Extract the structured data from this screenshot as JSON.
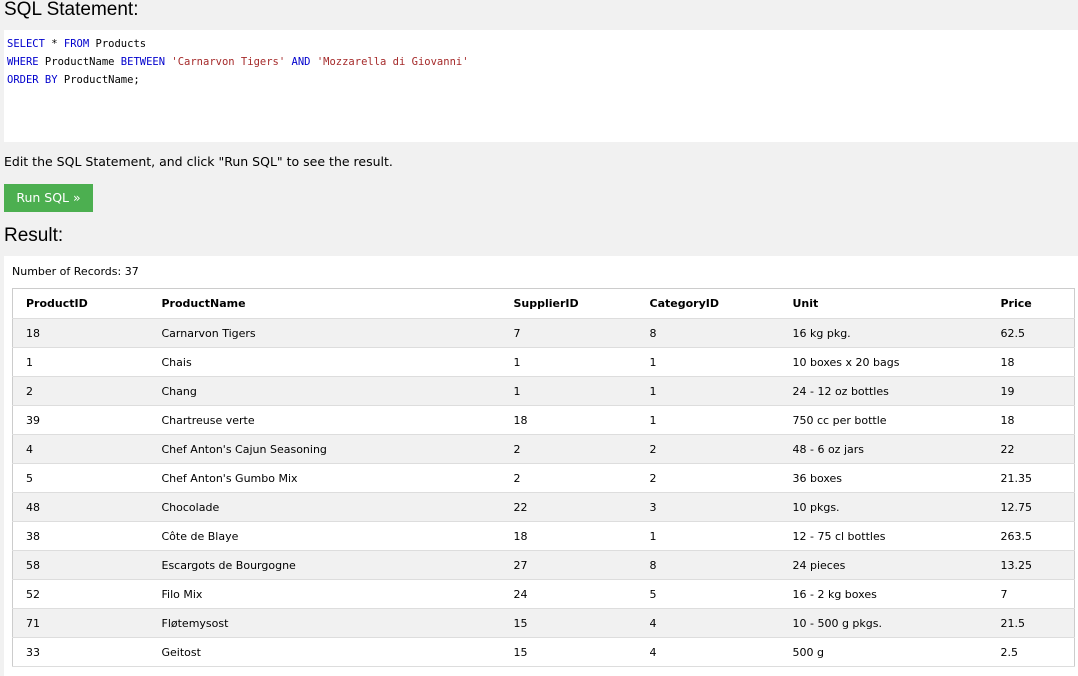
{
  "sql_heading": "SQL Statement:",
  "sql": {
    "line1": {
      "k1": "SELECT",
      "t1": " * ",
      "k2": "FROM",
      "t2": " Products"
    },
    "line2": {
      "k1": "WHERE",
      "t1": " ProductName ",
      "k2": "BETWEEN",
      "s1": "'Carnarvon Tigers'",
      "k3": "AND",
      "s2": "'Mozzarella di Giovanni'"
    },
    "line3": {
      "k1": "ORDER BY",
      "t1": " ProductName;"
    }
  },
  "instruction": "Edit the SQL Statement, and click \"Run SQL\" to see the result.",
  "run_button": "Run SQL »",
  "result_heading": "Result:",
  "record_count": "Number of Records: 37",
  "columns": [
    "ProductID",
    "ProductName",
    "SupplierID",
    "CategoryID",
    "Unit",
    "Price"
  ],
  "rows": [
    [
      "18",
      "Carnarvon Tigers",
      "7",
      "8",
      "16 kg pkg.",
      "62.5"
    ],
    [
      "1",
      "Chais",
      "1",
      "1",
      "10 boxes x 20 bags",
      "18"
    ],
    [
      "2",
      "Chang",
      "1",
      "1",
      "24 - 12 oz bottles",
      "19"
    ],
    [
      "39",
      "Chartreuse verte",
      "18",
      "1",
      "750 cc per bottle",
      "18"
    ],
    [
      "4",
      "Chef Anton's Cajun Seasoning",
      "2",
      "2",
      "48 - 6 oz jars",
      "22"
    ],
    [
      "5",
      "Chef Anton's Gumbo Mix",
      "2",
      "2",
      "36 boxes",
      "21.35"
    ],
    [
      "48",
      "Chocolade",
      "22",
      "3",
      "10 pkgs.",
      "12.75"
    ],
    [
      "38",
      "Côte de Blaye",
      "18",
      "1",
      "12 - 75 cl bottles",
      "263.5"
    ],
    [
      "58",
      "Escargots de Bourgogne",
      "27",
      "8",
      "24 pieces",
      "13.25"
    ],
    [
      "52",
      "Filo Mix",
      "24",
      "5",
      "16 - 2 kg boxes",
      "7"
    ],
    [
      "71",
      "Fløtemysost",
      "15",
      "4",
      "10 - 500 g pkgs.",
      "21.5"
    ],
    [
      "33",
      "Geitost",
      "15",
      "4",
      "500 g",
      "2.5"
    ]
  ],
  "colors": {
    "run_button": "#4caf50",
    "keyword": "#0000cd",
    "string": "#a52a2a"
  }
}
